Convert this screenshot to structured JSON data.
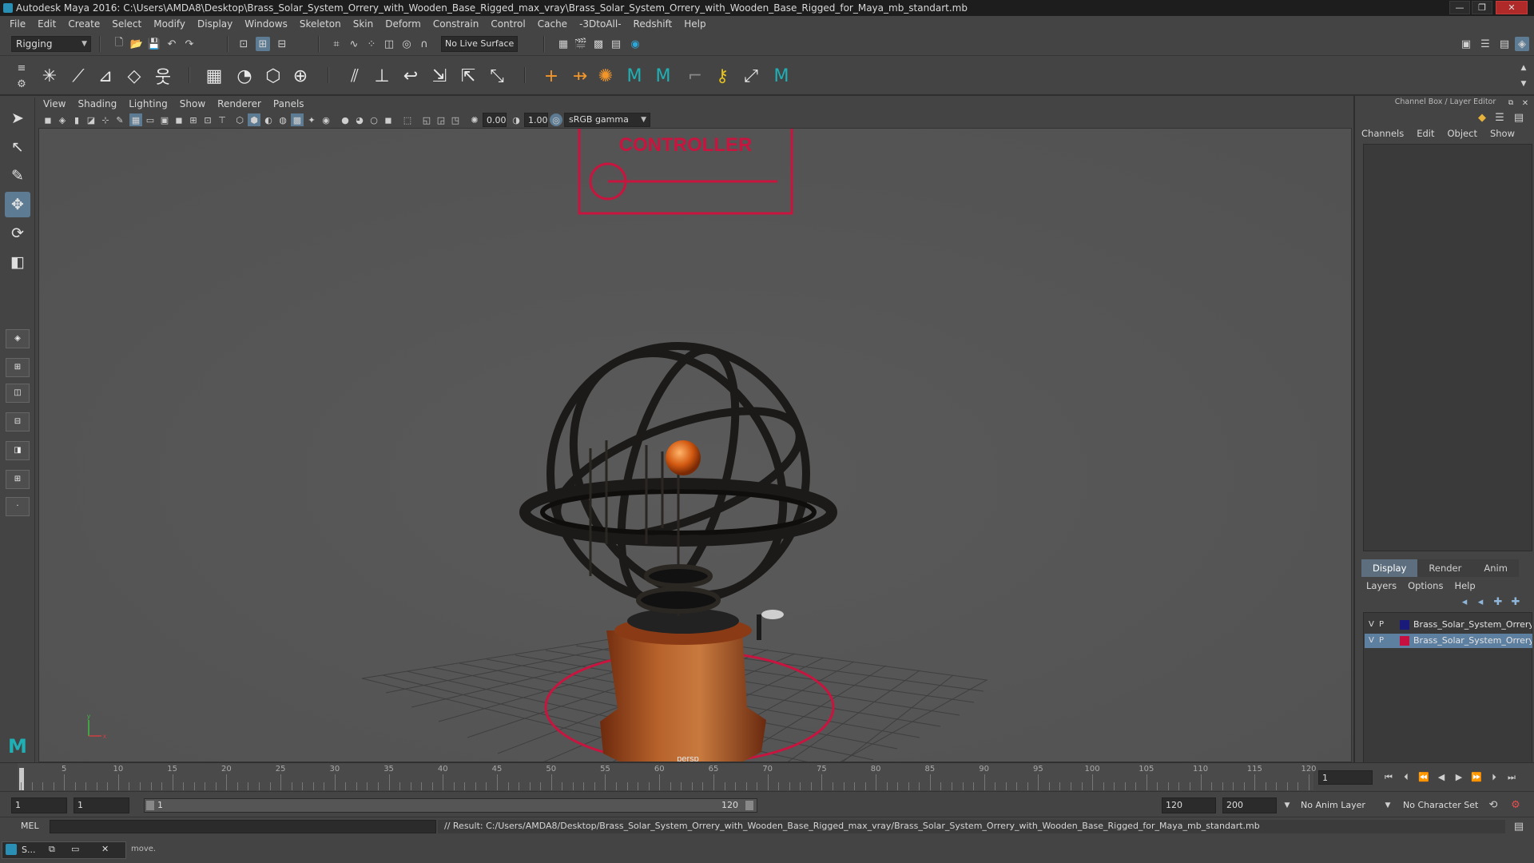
{
  "window": {
    "title": "Autodesk Maya 2016: C:\\Users\\AMDA8\\Desktop\\Brass_Solar_System_Orrery_with_Wooden_Base_Rigged_max_vray\\Brass_Solar_System_Orrery_with_Wooden_Base_Rigged_for_Maya_mb_standart.mb",
    "minimize": "—",
    "maximize": "❐",
    "close": "✕"
  },
  "menubar": [
    "File",
    "Edit",
    "Create",
    "Select",
    "Modify",
    "Display",
    "Windows",
    "Skeleton",
    "Skin",
    "Deform",
    "Constrain",
    "Control",
    "Cache",
    "-3DtoAll-",
    "Redshift",
    "Help"
  ],
  "statusline": {
    "mode_menu": "Rigging",
    "live_surface": "No Live Surface"
  },
  "viewport": {
    "menus": [
      "View",
      "Shading",
      "Lighting",
      "Show",
      "Renderer",
      "Panels"
    ],
    "field_a": "0.00",
    "field_b": "1.00",
    "color_space": "sRGB gamma",
    "camera_label": "persp",
    "controller_label": "CONTROLLER",
    "axis_y": "y",
    "axis_x": "x"
  },
  "channel_box": {
    "title": "Channel Box / Layer Editor",
    "menus": [
      "Channels",
      "Edit",
      "Object",
      "Show"
    ]
  },
  "layer_editor": {
    "tabs": [
      "Display",
      "Render",
      "Anim"
    ],
    "active_tab": "Display",
    "menus": [
      "Layers",
      "Options",
      "Help"
    ],
    "layers": [
      {
        "v": "V",
        "p": "P",
        "name": "Brass_Solar_System_Orrery_with_Wooden_Base",
        "color": "#1a1a7a",
        "selected": false
      },
      {
        "v": "V",
        "p": "P",
        "name": "Brass_Solar_System_Orrery_with_Wooden_Base",
        "color": "#c81040",
        "selected": true
      }
    ]
  },
  "timeline": {
    "ticks": [
      "1",
      "5",
      "10",
      "15",
      "20",
      "25",
      "30",
      "35",
      "40",
      "45",
      "50",
      "55",
      "60",
      "65",
      "70",
      "75",
      "80",
      "85",
      "90",
      "95",
      "100",
      "105",
      "110",
      "115",
      "120"
    ],
    "current_frame": "1"
  },
  "range": {
    "start": "1",
    "playback_start": "1",
    "range_start_label": "1",
    "range_end_label": "120",
    "playback_end": "120",
    "end": "200",
    "anim_layer": "No Anim Layer",
    "character_set": "No Character Set"
  },
  "cmdline": {
    "language": "MEL",
    "result": "// Result: C:/Users/AMDA8/Desktop/Brass_Solar_System_Orrery_with_Wooden_Base_Rigged_max_vray/Brass_Solar_System_Orrery_with_Wooden_Base_Rigged_for_Maya_mb_standart.mb"
  },
  "helpline": {
    "text": "move.",
    "task_label": "S..."
  },
  "colors": {
    "accent": "#5d7b93",
    "controller": "#c8153f"
  }
}
